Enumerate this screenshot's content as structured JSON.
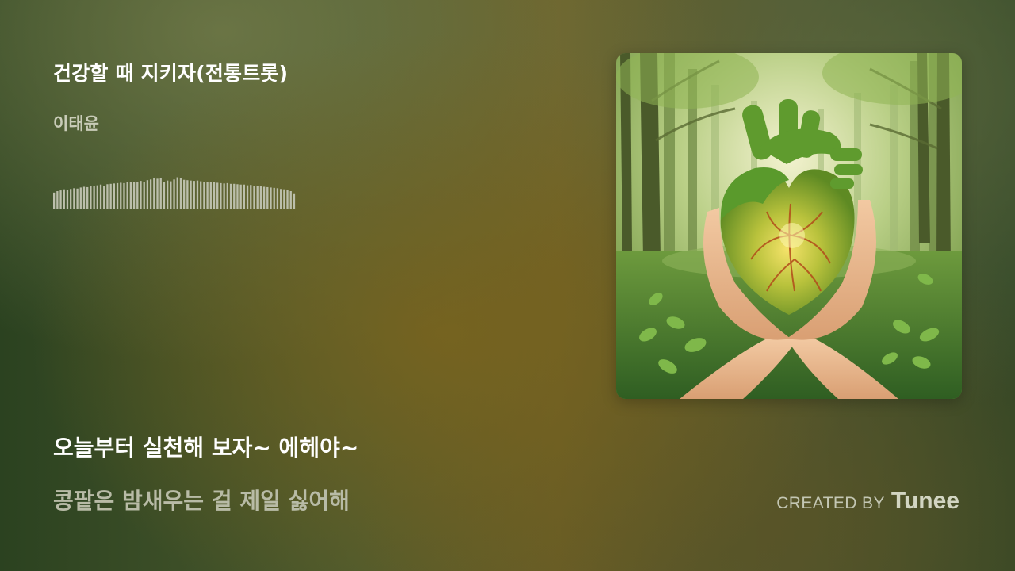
{
  "player": {
    "song_title": "건강할 때 지키자(전통트롯)",
    "artist": "이태윤",
    "waveform_levels": [
      0.46,
      0.5,
      0.52,
      0.55,
      0.54,
      0.56,
      0.58,
      0.57,
      0.6,
      0.62,
      0.61,
      0.63,
      0.64,
      0.66,
      0.68,
      0.64,
      0.69,
      0.7,
      0.71,
      0.72,
      0.73,
      0.72,
      0.74,
      0.75,
      0.76,
      0.75,
      0.78,
      0.76,
      0.8,
      0.82,
      0.87,
      0.84,
      0.86,
      0.74,
      0.79,
      0.77,
      0.82,
      0.88,
      0.86,
      0.81,
      0.8,
      0.79,
      0.78,
      0.79,
      0.77,
      0.76,
      0.75,
      0.76,
      0.74,
      0.73,
      0.72,
      0.71,
      0.72,
      0.7,
      0.7,
      0.69,
      0.68,
      0.68,
      0.66,
      0.67,
      0.65,
      0.64,
      0.63,
      0.62,
      0.61,
      0.6,
      0.59,
      0.58,
      0.56,
      0.55,
      0.53,
      0.5,
      0.44
    ],
    "waveform_color": "#bcbfac",
    "album_art_subject": "heart-in-hands-forest-illustration"
  },
  "lyrics": {
    "current": "오늘부터 실천해 보자~ 에헤야~",
    "next": "콩팥은 밤새우는 걸 제일 싫어해"
  },
  "credit": {
    "prefix": "CREATED BY",
    "brand": "Tunee"
  }
}
